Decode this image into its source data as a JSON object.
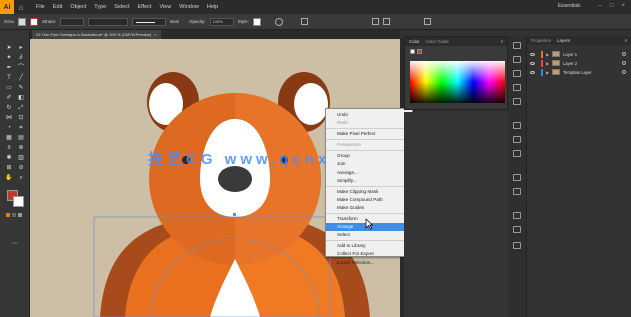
{
  "menubar": {
    "logo": "Ai",
    "items": [
      "File",
      "Edit",
      "Object",
      "Type",
      "Select",
      "Effect",
      "View",
      "Window",
      "Help"
    ],
    "workspace": "Essentials"
  },
  "controlbar": {
    "selection_label": "Grou",
    "stroke_label": "Stroke:",
    "stroke_profile": "Basi",
    "opacity_label": "Opacity:",
    "opacity_value": "100%",
    "style_label": "Style:"
  },
  "document_tab": {
    "title": "03 Trim Font Overlaps in Illustrator.ai* @ 100 % (CMYK/Preview)"
  },
  "watermark": "技艺CG  www.qcnxfb.cn",
  "context_menu": {
    "items": [
      {
        "label": "Undo",
        "disabled": false,
        "submenu": false,
        "sep_after": false
      },
      {
        "label": "Redo",
        "disabled": true,
        "submenu": false,
        "sep_after": true
      },
      {
        "label": "Make Pixel Perfect",
        "disabled": false,
        "submenu": false,
        "sep_after": true
      },
      {
        "label": "Perspective",
        "disabled": true,
        "submenu": true,
        "sep_after": true
      },
      {
        "label": "Group",
        "disabled": false,
        "submenu": false,
        "sep_after": false
      },
      {
        "label": "Join",
        "disabled": false,
        "submenu": false,
        "sep_after": false
      },
      {
        "label": "Average...",
        "disabled": false,
        "submenu": false,
        "sep_after": false
      },
      {
        "label": "Simplify...",
        "disabled": false,
        "submenu": false,
        "sep_after": true
      },
      {
        "label": "Make Clipping Mask",
        "disabled": false,
        "submenu": false,
        "sep_after": false
      },
      {
        "label": "Make Compound Path",
        "disabled": false,
        "submenu": false,
        "sep_after": false
      },
      {
        "label": "Make Guides",
        "disabled": false,
        "submenu": false,
        "sep_after": true
      },
      {
        "label": "Transform",
        "disabled": false,
        "submenu": true,
        "sep_after": false
      },
      {
        "label": "Arrange",
        "disabled": false,
        "submenu": true,
        "active": true,
        "sep_after": false
      },
      {
        "label": "Select",
        "disabled": false,
        "submenu": true,
        "sep_after": true
      },
      {
        "label": "Add to Library",
        "disabled": false,
        "submenu": false,
        "sep_after": false
      },
      {
        "label": "Collect For Export",
        "disabled": false,
        "submenu": true,
        "sep_after": false
      },
      {
        "label": "Export Selection...",
        "disabled": false,
        "submenu": false,
        "sep_after": false
      }
    ]
  },
  "color_panel": {
    "tabs": [
      "Color",
      "Color Guide"
    ]
  },
  "layers_panel": {
    "tabs": [
      "Properties",
      "Layers"
    ],
    "layers": [
      {
        "name": "Layer 1",
        "color": "#ff6a00"
      },
      {
        "name": "Layer 2",
        "color": "#ff3b3b"
      },
      {
        "name": "Template Layer",
        "color": "#3b7dff"
      }
    ]
  },
  "colors": {
    "canvas_bg": "#ccbfa5",
    "bear_orange": "#de6a22",
    "bear_dark": "#a84b1c",
    "highlight": "#3d8ee6",
    "accent": "#ff9a00"
  }
}
